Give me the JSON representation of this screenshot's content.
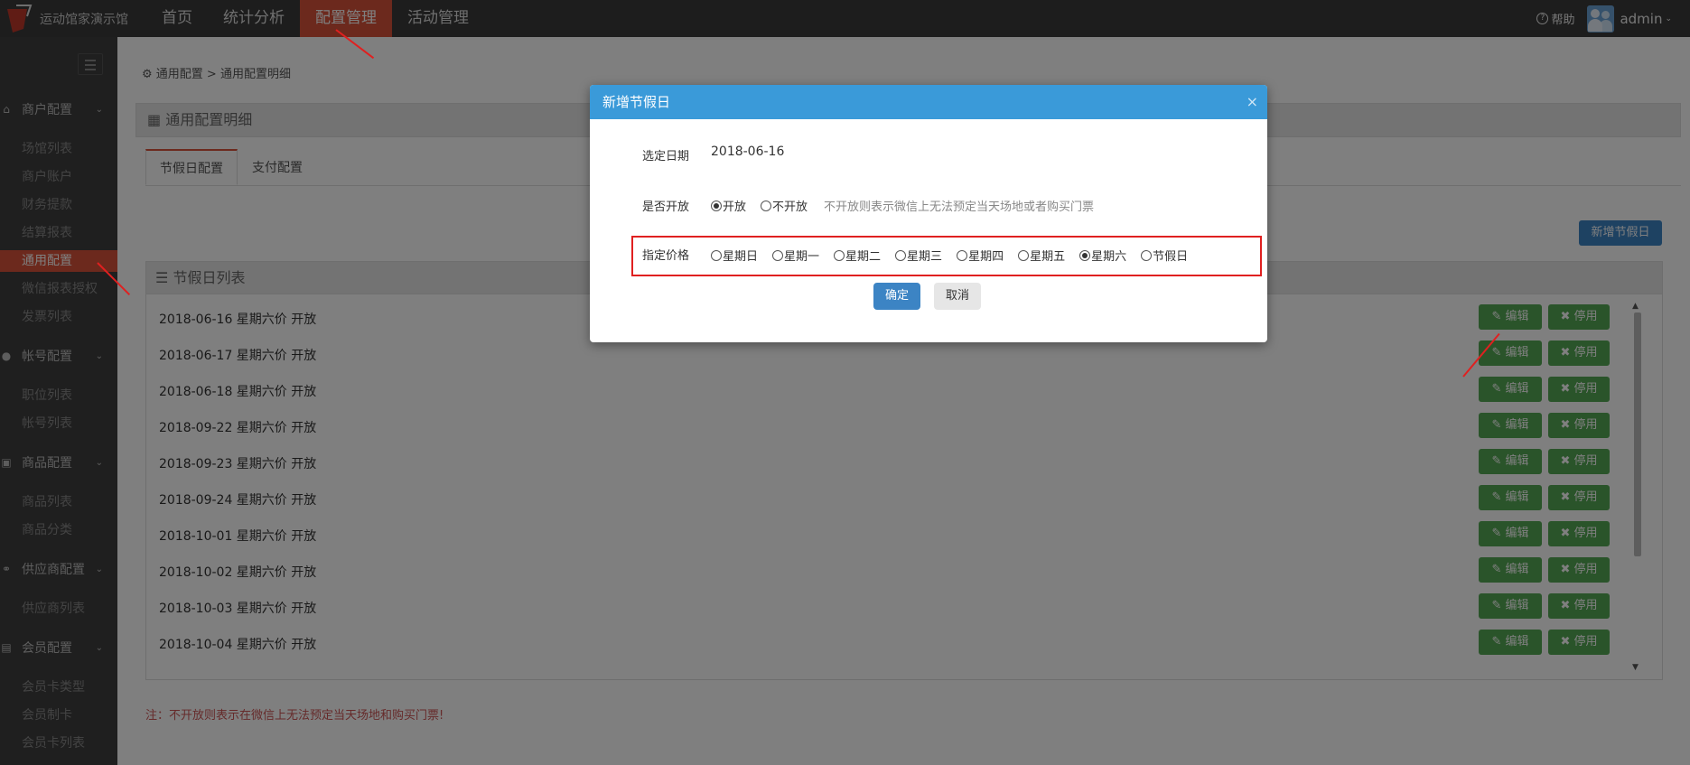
{
  "app": {
    "logo_text": "运动馆家演示馆"
  },
  "nav": [
    {
      "label": "首页"
    },
    {
      "label": "统计分析"
    },
    {
      "label": "配置管理"
    },
    {
      "label": "活动管理"
    }
  ],
  "topright": {
    "help": "帮助",
    "user": "admin"
  },
  "sidebar": {
    "groups": [
      {
        "label": "商户配置",
        "icon": "home-icon",
        "items": [
          "场馆列表",
          "商户账户",
          "财务提款",
          "结算报表",
          "通用配置",
          "微信报表授权",
          "发票列表"
        ]
      },
      {
        "label": "帐号配置",
        "icon": "user-icon",
        "items": [
          "职位列表",
          "帐号列表"
        ]
      },
      {
        "label": "商品配置",
        "icon": "gift-icon",
        "items": [
          "商品列表",
          "商品分类"
        ]
      },
      {
        "label": "供应商配置",
        "icon": "link-icon",
        "items": [
          "供应商列表"
        ]
      },
      {
        "label": "会员配置",
        "icon": "card-icon",
        "items": [
          "会员卡类型",
          "会员制卡",
          "会员卡列表"
        ]
      }
    ],
    "active_item": "通用配置"
  },
  "main": {
    "breadcrumb": "通用配置 > 通用配置明细",
    "panel_title": "通用配置明细",
    "tabs": [
      "节假日配置",
      "支付配置"
    ],
    "add_button": "新增节假日",
    "list_title": "节假日列表",
    "rows": [
      "2018-06-16 星期六价 开放",
      "2018-06-17 星期六价 开放",
      "2018-06-18 星期六价 开放",
      "2018-09-22 星期六价 开放",
      "2018-09-23 星期六价 开放",
      "2018-09-24 星期六价 开放",
      "2018-10-01 星期六价 开放",
      "2018-10-02 星期六价 开放",
      "2018-10-03 星期六价 开放",
      "2018-10-04 星期六价 开放"
    ],
    "edit_label": "编辑",
    "stop_label": "停用",
    "note": "注：不开放则表示在微信上无法预定当天场地和购买门票!"
  },
  "modal": {
    "title": "新增节假日",
    "close": "×",
    "date_label": "选定日期",
    "date_value": "2018-06-16",
    "open_label": "是否开放",
    "open_options": [
      "开放",
      "不开放"
    ],
    "open_selected": 0,
    "open_hint": "不开放则表示微信上无法预定当天场地或者购买门票",
    "price_label": "指定价格",
    "price_options": [
      "星期日",
      "星期一",
      "星期二",
      "星期三",
      "星期四",
      "星期五",
      "星期六",
      "节假日"
    ],
    "price_selected": 6,
    "ok": "确定",
    "cancel": "取消"
  },
  "colors": {
    "accent": "#d9533a",
    "primary": "#3c84c4",
    "success": "#55a854",
    "modal_header": "#3a9ad9",
    "highlight": "#e02020"
  }
}
